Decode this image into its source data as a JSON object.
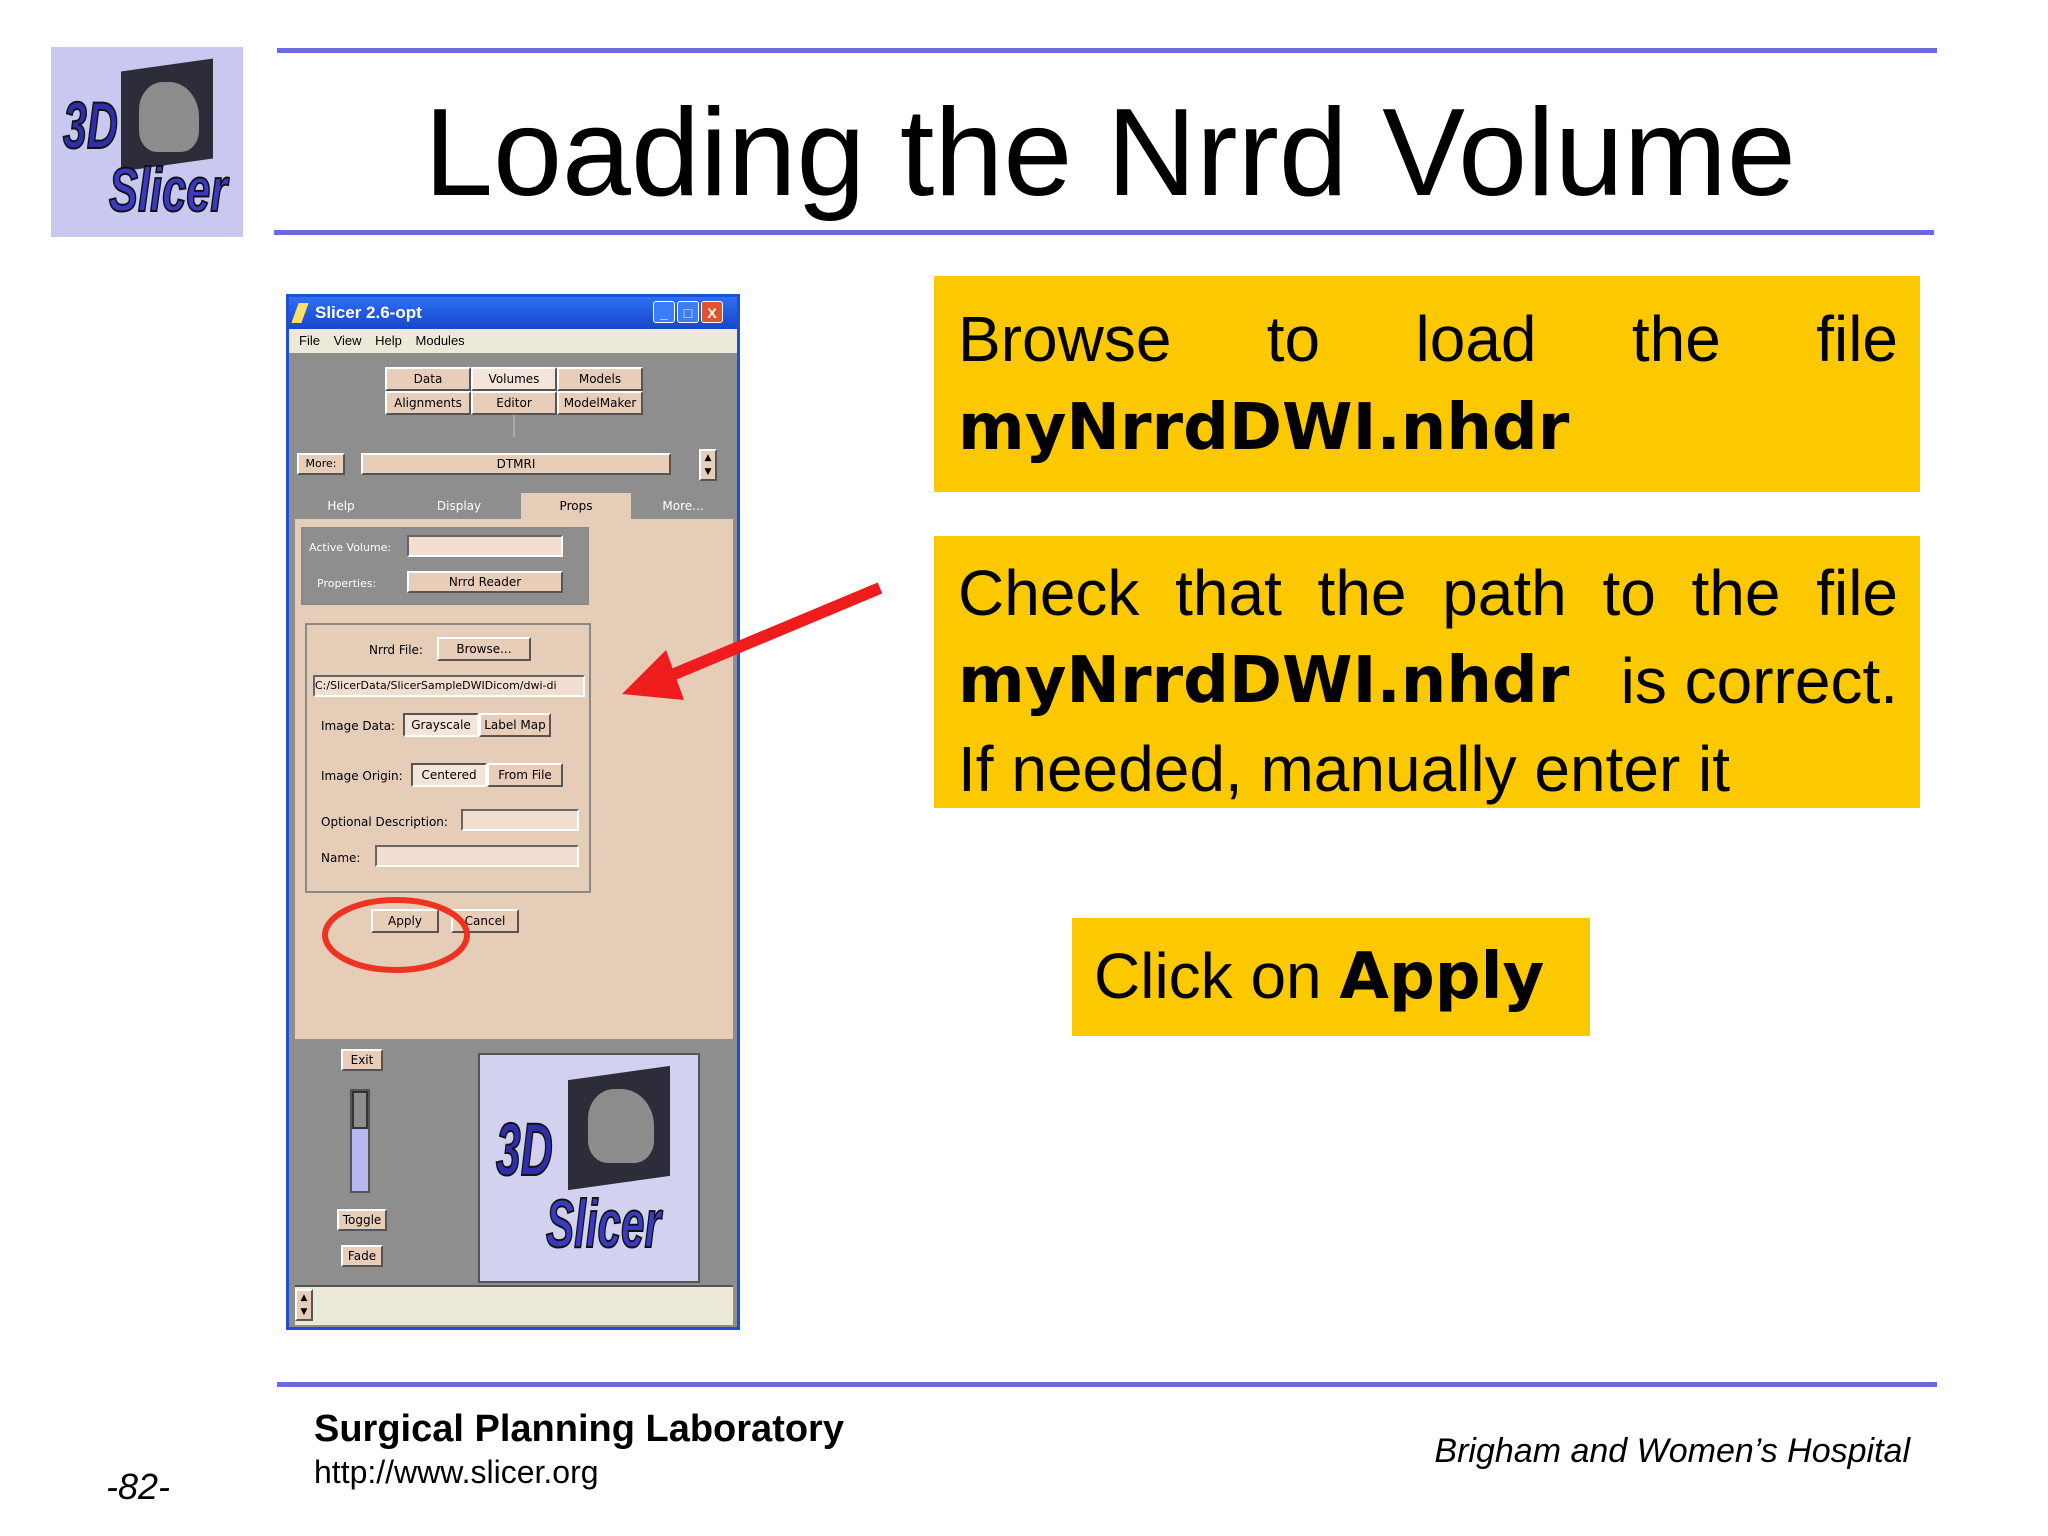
{
  "slide": {
    "title": "Loading the Nrrd Volume",
    "logo_line1": "3D",
    "logo_line2": "Slicer"
  },
  "window": {
    "title": "Slicer 2.6-opt",
    "menu": [
      "File",
      "View",
      "Help",
      "Modules"
    ],
    "module_buttons": [
      "Data",
      "Volumes",
      "Models",
      "Alignments",
      "Editor",
      "ModelMaker"
    ],
    "more_label": "More:",
    "more_value": "DTMRI",
    "tabs": [
      "Help",
      "Display",
      "Props",
      "More..."
    ],
    "active_volume_label": "Active Volume:",
    "properties_label": "Properties:",
    "properties_value": "Nrrd Reader",
    "nrrd_file_label": "Nrrd File:",
    "browse_label": "Browse...",
    "file_path": "C:/SlicerData/SlicerSampleDWIDicom/dwi-di",
    "image_data_label": "Image Data:",
    "image_data_options": [
      "Grayscale",
      "Label Map"
    ],
    "image_origin_label": "Image Origin:",
    "image_origin_options": [
      "Centered",
      "From File"
    ],
    "optional_description_label": "Optional Description:",
    "name_label": "Name:",
    "apply_label": "Apply",
    "cancel_label": "Cancel",
    "exit_label": "Exit",
    "toggle_label": "Toggle",
    "fade_label": "Fade",
    "minimize_glyph": "_",
    "maximize_glyph": "□",
    "close_glyph": "X",
    "spin_up_glyph": "▲",
    "spin_down_glyph": "▼"
  },
  "callouts": {
    "c1_words": [
      "Browse",
      "to",
      "load",
      "the",
      "file"
    ],
    "c1_bold": "myNrrdDWI.nhdr",
    "c2_line1": "Check that the path to the file",
    "c2_bold": "myNrrdDWI.nhdr",
    "c2_line2_rest": "is correct.",
    "c2_line3": "If needed, manually enter it",
    "c3_text": "Click on ",
    "c3_bold": "Apply"
  },
  "footer": {
    "lab": "Surgical Planning Laboratory",
    "url": "http://www.slicer.org",
    "page": "-82-",
    "hospital": "Brigham and Women’s Hospital"
  },
  "colors": {
    "rule": "#6b6bdf",
    "callout_bg": "#fcc800",
    "arrow": "#ee1c1c",
    "highlight_ellipse": "#ee3322"
  }
}
